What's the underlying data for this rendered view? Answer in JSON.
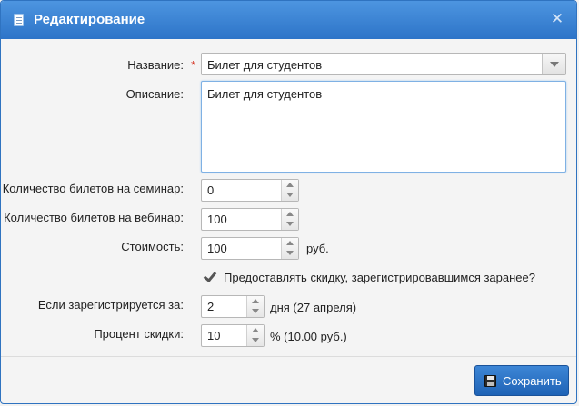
{
  "dialog": {
    "title": "Редактирование",
    "close_symbol": "✕",
    "icons": {
      "title": "document-icon",
      "close": "close-icon",
      "save": "save-icon",
      "checkbox": "checkmark-icon"
    }
  },
  "form": {
    "name": {
      "label": "Название:",
      "required_mark": "*",
      "value": "Билет для студентов"
    },
    "description": {
      "label": "Описание:",
      "value": "Билет для студентов"
    },
    "seminar_tickets": {
      "label": "Количество билетов на семинар:",
      "value": "0"
    },
    "webinar_tickets": {
      "label": "Количество билетов на вебинар:",
      "value": "100"
    },
    "price": {
      "label": "Стоимость:",
      "value": "100",
      "suffix": "руб."
    },
    "early_discount": {
      "checked": true,
      "label": "Предоставлять скидку, зарегистрировавшимся заранее?"
    },
    "register_before": {
      "label": "Если зарегистрируется за:",
      "value": "2",
      "suffix": "дня (27 апреля)"
    },
    "discount_percent": {
      "label": "Процент скидки:",
      "value": "10",
      "suffix": "% (10.00 руб.)"
    }
  },
  "footer": {
    "save_label": "Сохранить"
  },
  "colors": {
    "titlebar": "#2d74c8",
    "accent": "#3d86d6",
    "required": "#d63a2a"
  }
}
